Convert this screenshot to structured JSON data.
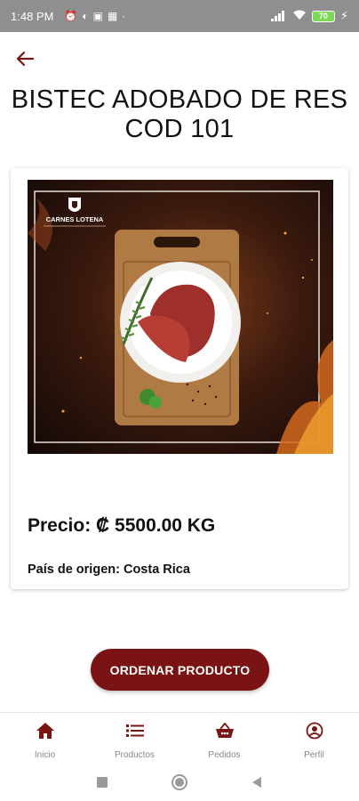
{
  "status_bar": {
    "time": "1:48 PM",
    "battery_level": "70",
    "icons": [
      "alarm-icon",
      "data-saver-icon",
      "nfc-icon",
      "qr-icon"
    ]
  },
  "header": {
    "title": "BISTEC ADOBADO DE RES COD 101"
  },
  "product": {
    "image_logo": "CARNES LOTENA",
    "price": "Precio: ₡ 5500.00 KG",
    "origin": "País de origen: Costa Rica"
  },
  "actions": {
    "order_label": "ORDENAR PRODUCTO"
  },
  "bottom_nav": [
    {
      "label": "Inicio",
      "icon": "home-icon",
      "active": true
    },
    {
      "label": "Productos",
      "icon": "list-icon",
      "active": false
    },
    {
      "label": "Pedidos",
      "icon": "basket-icon",
      "active": false
    },
    {
      "label": "Perfil",
      "icon": "profile-icon",
      "active": false
    }
  ],
  "colors": {
    "accent": "#7a1414",
    "status_bar": "#8f8f8f",
    "nav_label": "#888888"
  }
}
